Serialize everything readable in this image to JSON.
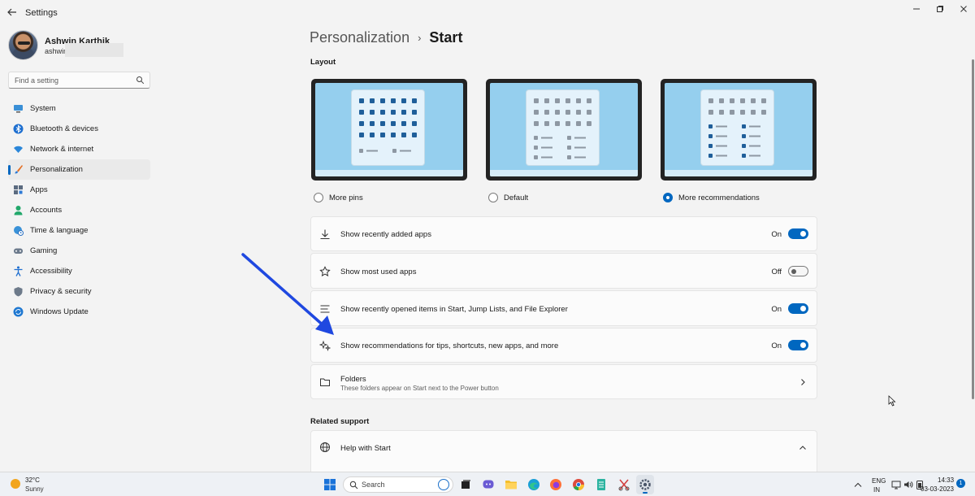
{
  "app": {
    "title": "Settings"
  },
  "profile": {
    "name": "Ashwin Karthik",
    "email": "ashwin"
  },
  "search": {
    "placeholder": "Find a setting"
  },
  "nav": {
    "items": [
      {
        "label": "System",
        "icon": "monitor-icon"
      },
      {
        "label": "Bluetooth & devices",
        "icon": "bluetooth-icon"
      },
      {
        "label": "Network & internet",
        "icon": "wifi-icon"
      },
      {
        "label": "Personalization",
        "icon": "brush-icon",
        "selected": true
      },
      {
        "label": "Apps",
        "icon": "apps-icon"
      },
      {
        "label": "Accounts",
        "icon": "person-icon"
      },
      {
        "label": "Time & language",
        "icon": "globe-clock-icon"
      },
      {
        "label": "Gaming",
        "icon": "controller-icon"
      },
      {
        "label": "Accessibility",
        "icon": "accessibility-icon"
      },
      {
        "label": "Privacy & security",
        "icon": "shield-icon"
      },
      {
        "label": "Windows Update",
        "icon": "update-icon"
      }
    ]
  },
  "breadcrumb": {
    "parent": "Personalization",
    "separator": "›",
    "current": "Start"
  },
  "layout": {
    "heading": "Layout",
    "options": [
      {
        "label": "More pins",
        "selected": false
      },
      {
        "label": "Default",
        "selected": false
      },
      {
        "label": "More recommendations",
        "selected": true
      }
    ]
  },
  "settings": [
    {
      "label": "Show recently added apps",
      "state": "On",
      "on": true,
      "icon": "download-icon"
    },
    {
      "label": "Show most used apps",
      "state": "Off",
      "on": false,
      "icon": "star-icon"
    },
    {
      "label": "Show recently opened items in Start, Jump Lists, and File Explorer",
      "state": "On",
      "on": true,
      "icon": "list-icon"
    },
    {
      "label": "Show recommendations for tips, shortcuts, new apps, and more",
      "state": "On",
      "on": true,
      "icon": "sparkle-icon"
    }
  ],
  "folders": {
    "label": "Folders",
    "sublabel": "These folders appear on Start next to the Power button"
  },
  "related": {
    "heading": "Related support",
    "help_label": "Help with Start"
  },
  "taskbar": {
    "weather_temp": "32°C",
    "weather_desc": "Sunny",
    "search_placeholder": "Search",
    "lang_top": "ENG",
    "lang_bottom": "IN",
    "time": "14:33",
    "date": "03-03-2023",
    "notification_count": "1"
  },
  "colors": {
    "accent": "#0067c0",
    "background": "#f3f3f3",
    "card": "#fbfbfb",
    "arrow": "#1f48e0"
  }
}
